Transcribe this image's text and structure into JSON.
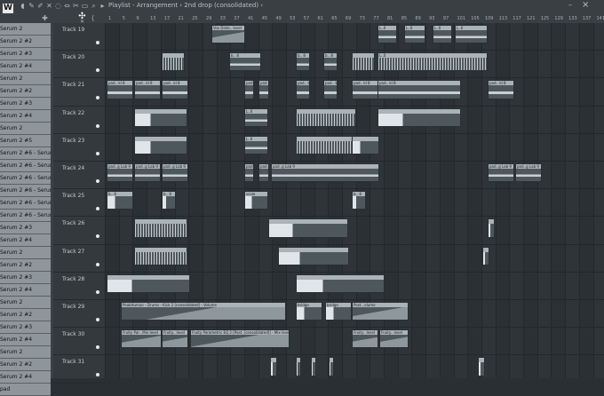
{
  "window": {
    "title": "Playlist - Arrangement › 2nd drop (consolidated) ›",
    "minimize_label": "–",
    "close_label": "×"
  },
  "toolbar_icons": [
    "piano-icon",
    "magnet-icon",
    "pencil-icon",
    "paint-icon",
    "delete-icon",
    "mute-icon",
    "slip-icon",
    "slice-icon",
    "select-icon",
    "zoom-icon",
    "playback-icon",
    "menu-icon"
  ],
  "timeline": {
    "ticks": [
      "1",
      "5",
      "9",
      "13",
      "17",
      "21",
      "25",
      "29",
      "33",
      "37",
      "41",
      "45",
      "49",
      "53",
      "57",
      "61",
      "65",
      "69",
      "73",
      "77",
      "81",
      "85",
      "89",
      "93",
      "97",
      "101",
      "105",
      "109",
      "113",
      "117",
      "121",
      "125",
      "129",
      "133",
      "137",
      "141"
    ]
  },
  "channels": [
    "Serum 2",
    "Serum 2 #2",
    "Serum 2 #3",
    "Serum 2 #4",
    "Serum 2",
    "Serum 2 #2",
    "Serum 2 #3",
    "Serum 2 #4",
    "Serum 2",
    "Serum 2 #5",
    "Serum 2 #6 - Serum 2",
    "Serum 2 #6 - Serum 2 #2",
    "Serum 2 #6 - Serum 2 #5",
    "Serum 2 #6 - Serum 2 #7",
    "Serum 2 #6 - Serum 2 #8",
    "Serum 2 #6 - Serum 2 #9",
    "Serum 2 #3",
    "Serum 2 #4",
    "Serum 2",
    "Serum 2 #2",
    "Serum 2 #3",
    "Serum 2 #4",
    "Serum 2",
    "Serum 2 #2",
    "Serum 2 #3",
    "Serum 2 #4",
    "Serum 2",
    "Serum 2 #2",
    "Serum 2 #4",
    "pad"
  ],
  "tracks": [
    "Track 19",
    "Track 20",
    "Track 21",
    "Track 22",
    "Track 23",
    "Track 24",
    "Track 25",
    "Track 26",
    "Track 27",
    "Track 28",
    "Track 29",
    "Track 30",
    "Track 31"
  ],
  "clip_labels": {
    "vox_distort": "Vox Disto.. level",
    "lead": "L..0",
    "pad": "pad.. kl 8",
    "pad_lab": "pad..g Lab 9",
    "bass": "b.. 8",
    "scale": "scale",
    "peakhum": "PeakHum.. 2 - Volume",
    "peakhum_vol": "Post.. olume",
    "peakhum_drums": "PeakHuman - Drums - Kick 2 [consolidated] - Volume",
    "fruity_par": "Fruity Par.. Mix level",
    "fruity_level": "Fruity.. level",
    "fruity_parametric": "Fruity Parametric EQ 2 [Post. [consolidated]] - Mix level",
    "bridge": "bridge"
  }
}
